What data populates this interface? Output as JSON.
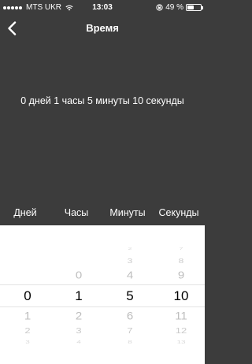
{
  "status_bar": {
    "carrier": "MTS UKR",
    "time": "13:03",
    "battery": "49 %",
    "battery_level": 0.49,
    "signal_bars": 5,
    "icons": [
      "signal-dots-icon",
      "wifi-icon",
      "rotation-lock-icon",
      "battery-icon"
    ]
  },
  "nav": {
    "title": "Время",
    "back_icon": "chevron-left-icon"
  },
  "summary": "0 дней 1 часы 5 минуты 10 секунды",
  "picker": {
    "headers": [
      "Дней",
      "Часы",
      "Минуты",
      "Секунды"
    ],
    "columns": [
      {
        "name": "days",
        "above": [],
        "selected": "0",
        "below": [
          "1",
          "2",
          "3"
        ]
      },
      {
        "name": "hours",
        "above": [
          "0"
        ],
        "selected": "1",
        "below": [
          "2",
          "3",
          "4"
        ]
      },
      {
        "name": "minutes",
        "above": [
          "2",
          "3",
          "4"
        ],
        "selected": "5",
        "below": [
          "6",
          "7",
          "8"
        ]
      },
      {
        "name": "seconds",
        "above": [
          "7",
          "8",
          "9"
        ],
        "selected": "10",
        "below": [
          "11",
          "12",
          "13"
        ]
      }
    ]
  },
  "colors": {
    "background": "#3c3c3c",
    "text": "#ffffff",
    "picker_background": "#ffffff",
    "picker_selected": "#000000",
    "picker_faded": "#a8a8a8"
  }
}
